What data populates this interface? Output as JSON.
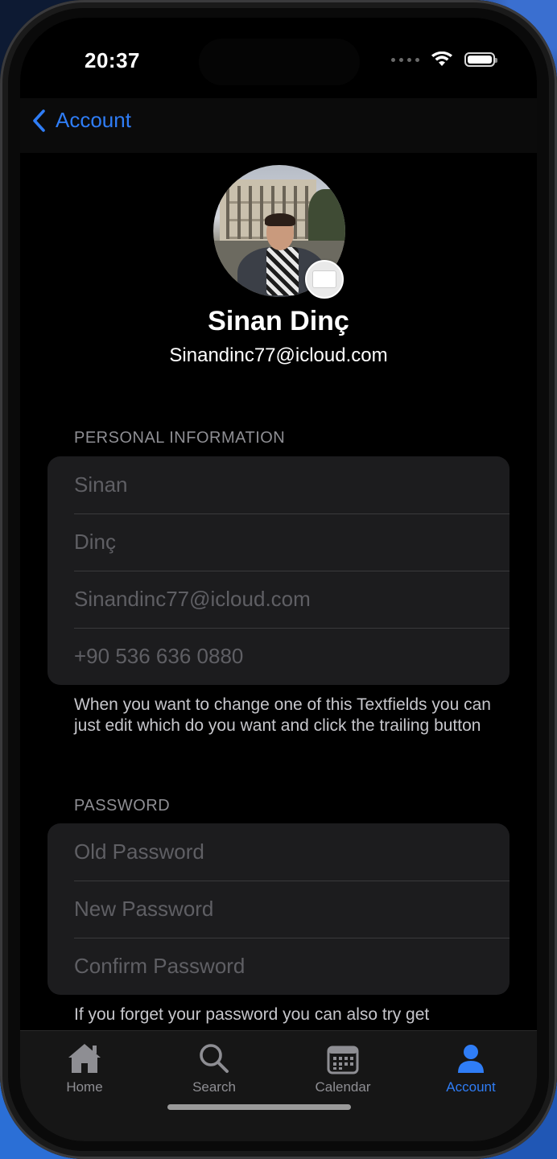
{
  "status_bar": {
    "time": "20:37"
  },
  "nav": {
    "back_label": "Account"
  },
  "profile": {
    "name": "Sinan Dinç",
    "email": "Sinandinc77@icloud.com"
  },
  "personal_info": {
    "header": "PERSONAL INFORMATION",
    "first_name_placeholder": "Sinan",
    "last_name_placeholder": "Dinç",
    "email_placeholder": "Sinandinc77@icloud.com",
    "phone_placeholder": "+90 536 636 0880",
    "footer": "When you want to change one of this Textfields you can just edit which do you want and click the trailing button"
  },
  "password": {
    "header": "PASSWORD",
    "old_placeholder": "Old Password",
    "new_placeholder": "New Password",
    "confirm_placeholder": "Confirm Password",
    "footer": "If you forget your password you can also try get"
  },
  "tab_bar": {
    "items": [
      {
        "label": "Home",
        "icon": "house-icon",
        "active": false
      },
      {
        "label": "Search",
        "icon": "magnifier-icon",
        "active": false
      },
      {
        "label": "Calendar",
        "icon": "calendar-icon",
        "active": false
      },
      {
        "label": "Account",
        "icon": "person-icon",
        "active": true
      }
    ]
  },
  "colors": {
    "accent": "#2f7df6",
    "background": "#000000",
    "grouped_cell": "#1c1c1e",
    "secondary_text": "#8e8e93"
  }
}
